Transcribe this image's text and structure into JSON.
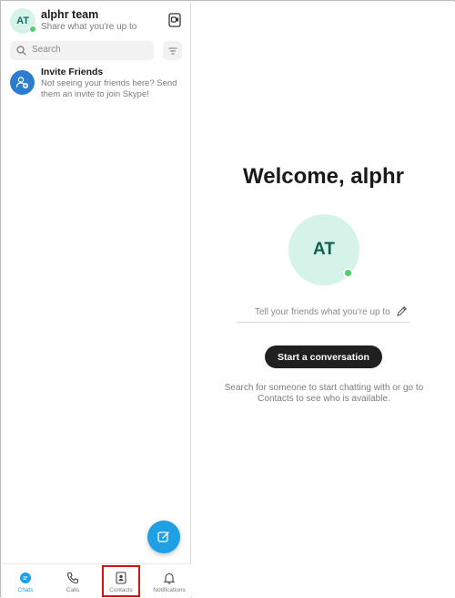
{
  "profile": {
    "initials": "AT",
    "name": "alphr team",
    "status": "Share what you're up to"
  },
  "search": {
    "placeholder": "Search"
  },
  "invite": {
    "title": "Invite Friends",
    "description": "Not seeing your friends here? Send them an invite to join Skype!"
  },
  "tabs": [
    {
      "label": "Chats",
      "icon": "chat-icon",
      "active": true
    },
    {
      "label": "Calls",
      "icon": "phone-icon",
      "active": false
    },
    {
      "label": "Contacts",
      "icon": "contacts-icon",
      "active": false,
      "highlighted": true
    },
    {
      "label": "Notifications",
      "icon": "bell-icon",
      "active": false
    }
  ],
  "welcome": {
    "title": "Welcome, alphr",
    "initials": "AT",
    "mood_placeholder": "Tell your friends what you're up to",
    "start_button": "Start a conversation",
    "hint": "Search for someone to start chatting with or go to Contacts to see who is available."
  },
  "colors": {
    "accent": "#1fa0e5",
    "online": "#4bd06c",
    "avatar_bg": "#d6f3ea",
    "highlight_box": "#d41515"
  }
}
